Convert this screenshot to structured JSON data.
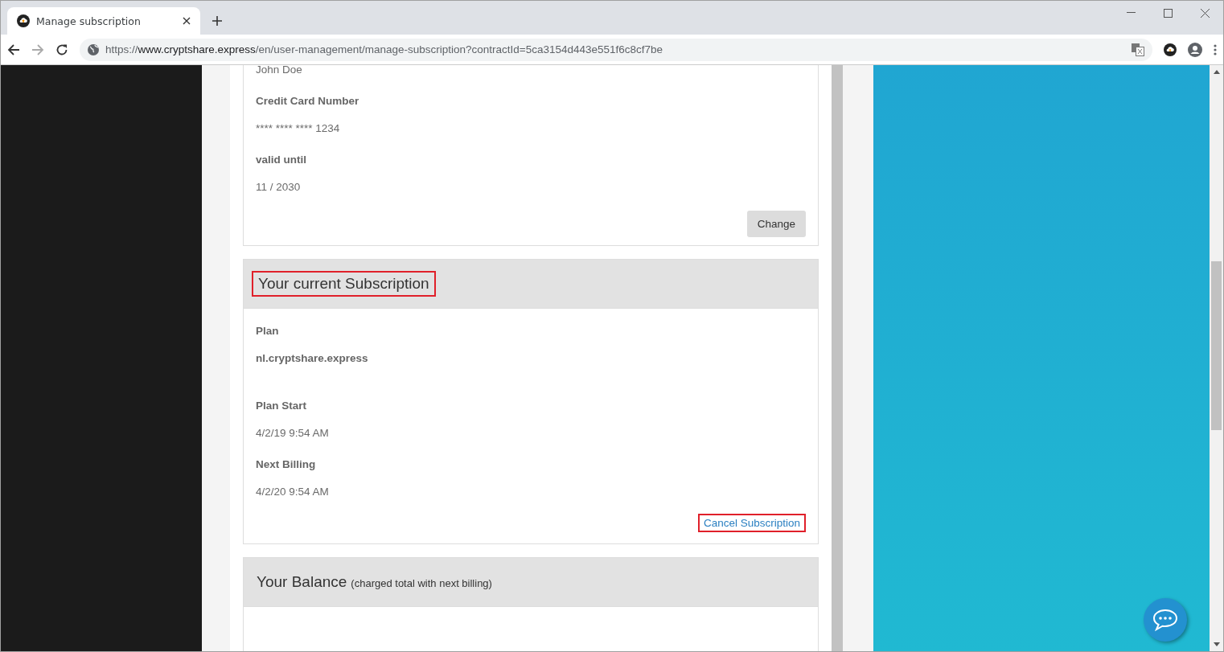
{
  "browser": {
    "tab": {
      "title": "Manage subscription",
      "selected": true
    },
    "url": {
      "scheme": "https://",
      "host": "www.cryptshare.express",
      "path": "/en/user-management/manage-subscription?contractId=5ca3154d443e551f6c8cf7be"
    }
  },
  "payment_card": {
    "fields": [
      {
        "label": "John Doe",
        "kind": "value"
      },
      {
        "label": "Credit Card Number",
        "kind": "label"
      },
      {
        "label": "**** **** **** 1234",
        "kind": "value"
      },
      {
        "label": "valid until",
        "kind": "label"
      },
      {
        "label": "11 / 2030",
        "kind": "value"
      }
    ],
    "button": "Change"
  },
  "subscription": {
    "title": "Your current Subscription",
    "title_highlighted": true,
    "fields": [
      {
        "label": "Plan",
        "kind": "label"
      },
      {
        "label": "nl.cryptshare.express",
        "kind": "strong"
      },
      {
        "label": "Plan Start",
        "kind": "label"
      },
      {
        "label": "4/2/19 9:54 AM",
        "kind": "value"
      },
      {
        "label": "Next Billing",
        "kind": "label"
      },
      {
        "label": "4/2/20 9:54 AM",
        "kind": "value"
      }
    ],
    "link": "Cancel Subscription",
    "link_highlighted": true
  },
  "balance": {
    "title": "Your Balance",
    "note": "(charged total with next billing)"
  }
}
